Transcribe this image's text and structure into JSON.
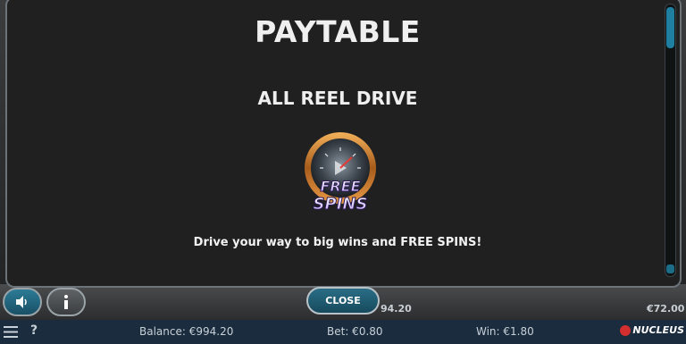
{
  "paytable": {
    "title": "PAYTABLE",
    "section": "ALL REEL DRIVE",
    "symbol_text_top": "FREE",
    "symbol_text_bottom": "SPINS",
    "description": "Drive your way to big wins and FREE SPINS!",
    "close_label": "CLOSE"
  },
  "background_values": {
    "left_value": "94.20",
    "right_value": "€72.00"
  },
  "status_bar": {
    "menu_icon": "hamburger-icon",
    "help_label": "?",
    "balance": "Balance: €994.20",
    "bet": "Bet: €0.80",
    "win": "Win: €1.80",
    "brand": "NUCLEUS"
  },
  "colors": {
    "accent": "#1f7fa0",
    "modal_bg": "#202020",
    "status_bar_bg": "#1a2c3d",
    "brand_red": "#d32f2f"
  }
}
